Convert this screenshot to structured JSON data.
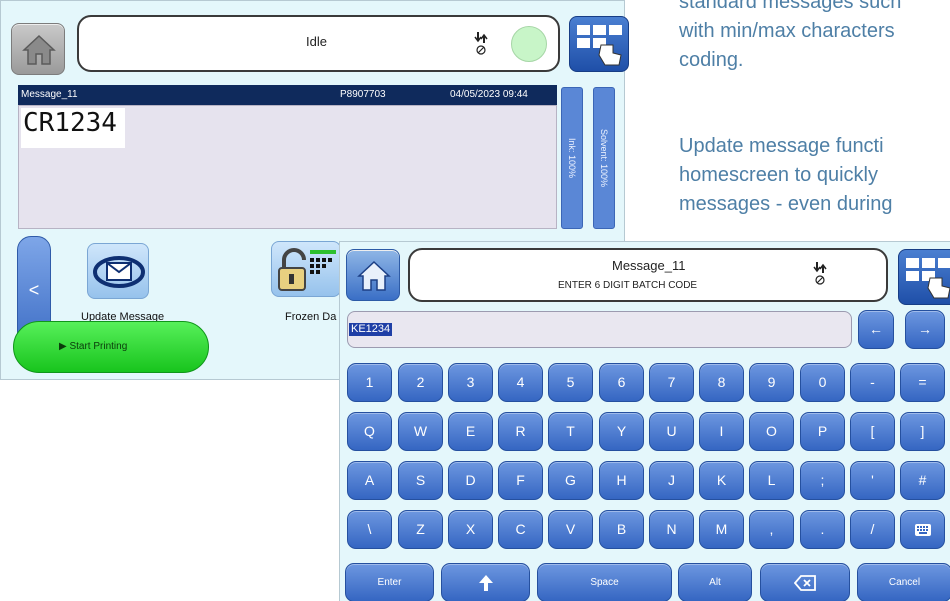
{
  "description": {
    "lines_top": [
      "standard messages such",
      "with min/max characters",
      "coding."
    ],
    "lines_bottom": [
      "Update message functi",
      "homescreen to quickly",
      "messages - even during"
    ],
    "text_color": "#4e7fa6"
  },
  "back_screen": {
    "status": "Idle",
    "message_name": "Message_11",
    "message_code": "P8907703",
    "datetime": "04/05/2023  09:44",
    "preview_text": "CR1234",
    "ink_label": "Ink: 100%",
    "solvent_label": "Solvent: 100%",
    "left_arrow": "<",
    "update_message_label": "Update Message",
    "frozen_label": "Frozen Da",
    "start_printing_label": "▶ Start Printing",
    "led_color": "#c8f5c8"
  },
  "keyboard_screen": {
    "title": "Message_11",
    "prompt": "ENTER 6 DIGIT BATCH CODE",
    "input_value": "KE1234",
    "nav_left": "←",
    "nav_right": "→",
    "row1": [
      "1",
      "2",
      "3",
      "4",
      "5",
      "6",
      "7",
      "8",
      "9",
      "0",
      "-",
      "="
    ],
    "row2": [
      "Q",
      "W",
      "E",
      "R",
      "T",
      "Y",
      "U",
      "I",
      "O",
      "P",
      "[",
      "]"
    ],
    "row3": [
      "A",
      "S",
      "D",
      "F",
      "G",
      "H",
      "J",
      "K",
      "L",
      ";",
      "'",
      "#"
    ],
    "row4": [
      "\\",
      "Z",
      "X",
      "C",
      "V",
      "B",
      "N",
      "M",
      ",",
      ".",
      "/",
      ""
    ],
    "enter_label": "Enter",
    "space_label": "Space",
    "alt_label": "Alt",
    "cancel_label": "Cancel",
    "key_color": "#3f70c8"
  },
  "icons": {
    "home": "home-icon",
    "menu": "menu-grid-icon",
    "ink": "ink-drop-icon",
    "lock": "lock-icon",
    "envelope": "envelope-icon",
    "backspace": "backspace-icon",
    "shift": "shift-arrow-icon",
    "keyboard": "keyboard-icon"
  }
}
